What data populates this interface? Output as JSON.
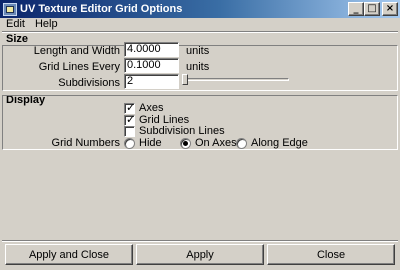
{
  "window": {
    "title": "UV Texture Editor Grid Options",
    "minimize_glyph": "_",
    "maximize_glyph": "□",
    "close_glyph": "×"
  },
  "menu": {
    "items": [
      {
        "label": "Edit"
      },
      {
        "label": "Help"
      }
    ]
  },
  "size_section": {
    "title": "Size",
    "length_and_width": {
      "label": "Length and Width",
      "value": "4.0000",
      "units": "units"
    },
    "grid_lines_every": {
      "label": "Grid Lines Every",
      "value": "0.1000",
      "units": "units"
    },
    "subdivisions": {
      "label": "Subdivisions",
      "value": "2",
      "slider_fraction": 0.0
    }
  },
  "display_section": {
    "title": "Display",
    "axes": {
      "label": "Axes",
      "checked": true
    },
    "grid_lines": {
      "label": "Grid Lines",
      "checked": true
    },
    "subdivision_lines": {
      "label": "Subdivision Lines",
      "checked": false
    },
    "grid_numbers": {
      "label": "Grid Numbers",
      "options": [
        {
          "label": "Hide",
          "selected": false
        },
        {
          "label": "On Axes",
          "selected": true
        },
        {
          "label": "Along Edge",
          "selected": false
        }
      ]
    }
  },
  "buttons": {
    "apply_and_close": "Apply and Close",
    "apply": "Apply",
    "close": "Close"
  }
}
